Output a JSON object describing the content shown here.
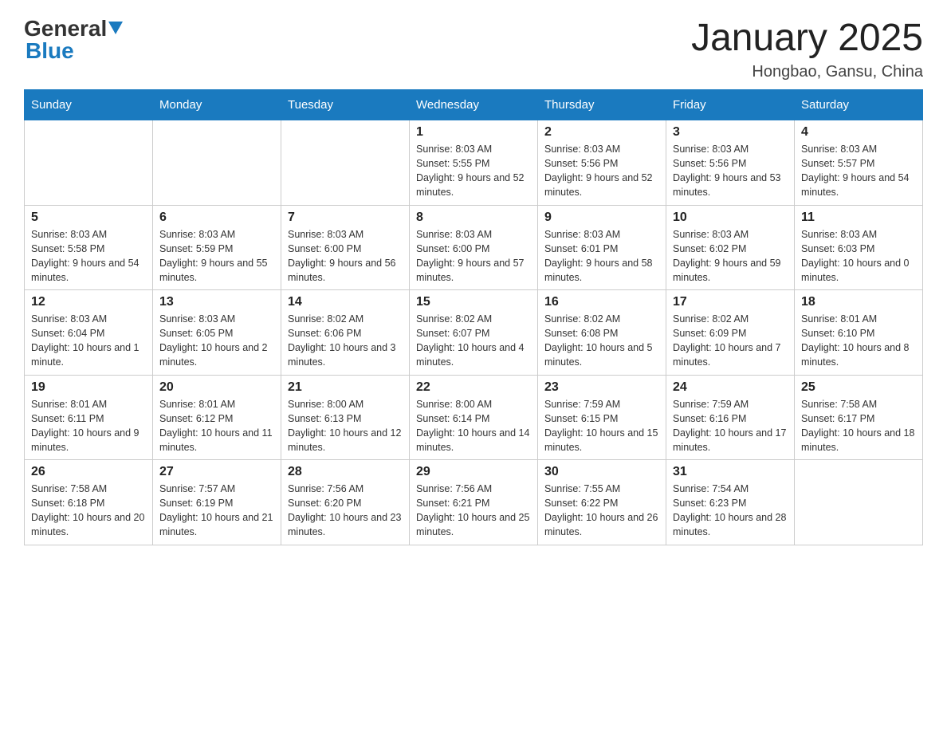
{
  "header": {
    "logo_general": "General",
    "logo_blue": "Blue",
    "title": "January 2025",
    "subtitle": "Hongbao, Gansu, China"
  },
  "days_of_week": [
    "Sunday",
    "Monday",
    "Tuesday",
    "Wednesday",
    "Thursday",
    "Friday",
    "Saturday"
  ],
  "weeks": [
    [
      {
        "day": "",
        "info": ""
      },
      {
        "day": "",
        "info": ""
      },
      {
        "day": "",
        "info": ""
      },
      {
        "day": "1",
        "info": "Sunrise: 8:03 AM\nSunset: 5:55 PM\nDaylight: 9 hours and 52 minutes."
      },
      {
        "day": "2",
        "info": "Sunrise: 8:03 AM\nSunset: 5:56 PM\nDaylight: 9 hours and 52 minutes."
      },
      {
        "day": "3",
        "info": "Sunrise: 8:03 AM\nSunset: 5:56 PM\nDaylight: 9 hours and 53 minutes."
      },
      {
        "day": "4",
        "info": "Sunrise: 8:03 AM\nSunset: 5:57 PM\nDaylight: 9 hours and 54 minutes."
      }
    ],
    [
      {
        "day": "5",
        "info": "Sunrise: 8:03 AM\nSunset: 5:58 PM\nDaylight: 9 hours and 54 minutes."
      },
      {
        "day": "6",
        "info": "Sunrise: 8:03 AM\nSunset: 5:59 PM\nDaylight: 9 hours and 55 minutes."
      },
      {
        "day": "7",
        "info": "Sunrise: 8:03 AM\nSunset: 6:00 PM\nDaylight: 9 hours and 56 minutes."
      },
      {
        "day": "8",
        "info": "Sunrise: 8:03 AM\nSunset: 6:00 PM\nDaylight: 9 hours and 57 minutes."
      },
      {
        "day": "9",
        "info": "Sunrise: 8:03 AM\nSunset: 6:01 PM\nDaylight: 9 hours and 58 minutes."
      },
      {
        "day": "10",
        "info": "Sunrise: 8:03 AM\nSunset: 6:02 PM\nDaylight: 9 hours and 59 minutes."
      },
      {
        "day": "11",
        "info": "Sunrise: 8:03 AM\nSunset: 6:03 PM\nDaylight: 10 hours and 0 minutes."
      }
    ],
    [
      {
        "day": "12",
        "info": "Sunrise: 8:03 AM\nSunset: 6:04 PM\nDaylight: 10 hours and 1 minute."
      },
      {
        "day": "13",
        "info": "Sunrise: 8:03 AM\nSunset: 6:05 PM\nDaylight: 10 hours and 2 minutes."
      },
      {
        "day": "14",
        "info": "Sunrise: 8:02 AM\nSunset: 6:06 PM\nDaylight: 10 hours and 3 minutes."
      },
      {
        "day": "15",
        "info": "Sunrise: 8:02 AM\nSunset: 6:07 PM\nDaylight: 10 hours and 4 minutes."
      },
      {
        "day": "16",
        "info": "Sunrise: 8:02 AM\nSunset: 6:08 PM\nDaylight: 10 hours and 5 minutes."
      },
      {
        "day": "17",
        "info": "Sunrise: 8:02 AM\nSunset: 6:09 PM\nDaylight: 10 hours and 7 minutes."
      },
      {
        "day": "18",
        "info": "Sunrise: 8:01 AM\nSunset: 6:10 PM\nDaylight: 10 hours and 8 minutes."
      }
    ],
    [
      {
        "day": "19",
        "info": "Sunrise: 8:01 AM\nSunset: 6:11 PM\nDaylight: 10 hours and 9 minutes."
      },
      {
        "day": "20",
        "info": "Sunrise: 8:01 AM\nSunset: 6:12 PM\nDaylight: 10 hours and 11 minutes."
      },
      {
        "day": "21",
        "info": "Sunrise: 8:00 AM\nSunset: 6:13 PM\nDaylight: 10 hours and 12 minutes."
      },
      {
        "day": "22",
        "info": "Sunrise: 8:00 AM\nSunset: 6:14 PM\nDaylight: 10 hours and 14 minutes."
      },
      {
        "day": "23",
        "info": "Sunrise: 7:59 AM\nSunset: 6:15 PM\nDaylight: 10 hours and 15 minutes."
      },
      {
        "day": "24",
        "info": "Sunrise: 7:59 AM\nSunset: 6:16 PM\nDaylight: 10 hours and 17 minutes."
      },
      {
        "day": "25",
        "info": "Sunrise: 7:58 AM\nSunset: 6:17 PM\nDaylight: 10 hours and 18 minutes."
      }
    ],
    [
      {
        "day": "26",
        "info": "Sunrise: 7:58 AM\nSunset: 6:18 PM\nDaylight: 10 hours and 20 minutes."
      },
      {
        "day": "27",
        "info": "Sunrise: 7:57 AM\nSunset: 6:19 PM\nDaylight: 10 hours and 21 minutes."
      },
      {
        "day": "28",
        "info": "Sunrise: 7:56 AM\nSunset: 6:20 PM\nDaylight: 10 hours and 23 minutes."
      },
      {
        "day": "29",
        "info": "Sunrise: 7:56 AM\nSunset: 6:21 PM\nDaylight: 10 hours and 25 minutes."
      },
      {
        "day": "30",
        "info": "Sunrise: 7:55 AM\nSunset: 6:22 PM\nDaylight: 10 hours and 26 minutes."
      },
      {
        "day": "31",
        "info": "Sunrise: 7:54 AM\nSunset: 6:23 PM\nDaylight: 10 hours and 28 minutes."
      },
      {
        "day": "",
        "info": ""
      }
    ]
  ]
}
